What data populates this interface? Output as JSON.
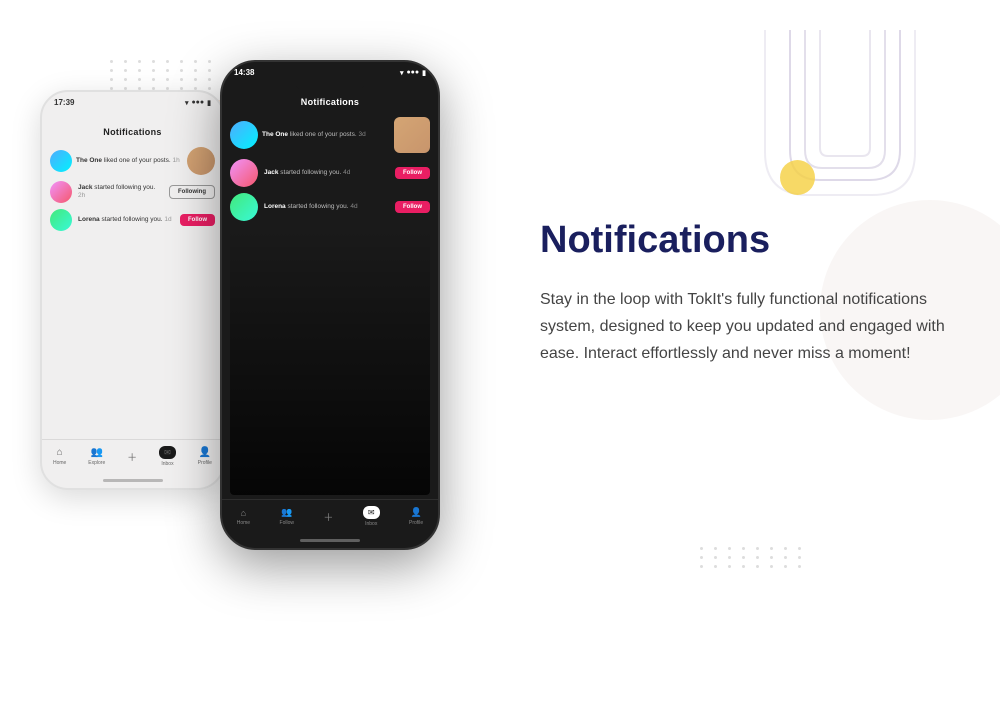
{
  "page": {
    "background": "#ffffff"
  },
  "phones": {
    "bg_phone": {
      "time": "17:39",
      "header": "Notifications",
      "notifications": [
        {
          "user": "The One",
          "action": "liked one of your posts.",
          "time": "1h",
          "has_img": true,
          "button": null
        },
        {
          "user": "Jack",
          "action": "started following you.",
          "time": "2h",
          "has_img": false,
          "button": "Following"
        },
        {
          "user": "Lorena",
          "action": "started following you.",
          "time": "1d",
          "has_img": false,
          "button": "Follow"
        }
      ],
      "nav_items": [
        "Home",
        "Explore",
        "+",
        "Inbox",
        "Profile"
      ]
    },
    "fg_phone": {
      "time": "14:38",
      "header": "Notifications",
      "notifications": [
        {
          "user": "The One",
          "action": "liked one of your posts.",
          "time": "3d",
          "has_img": true,
          "button": null
        },
        {
          "user": "Jack",
          "action": "started following you.",
          "time": "4d",
          "has_img": false,
          "button": "Follow"
        },
        {
          "user": "Lorena",
          "action": "started following you.",
          "time": "4d",
          "has_img": false,
          "button": "Follow"
        }
      ],
      "nav_items": [
        "Home",
        "Follow",
        "+",
        "Inbox",
        "Profile"
      ]
    }
  },
  "content": {
    "title": "Notifications",
    "description": "Stay in the loop with TokIt's fully functional notifications system, designed to keep you updated and engaged with ease. Interact effortlessly and never miss a moment!"
  },
  "buttons": {
    "follow": "Follow",
    "following": "Following"
  }
}
